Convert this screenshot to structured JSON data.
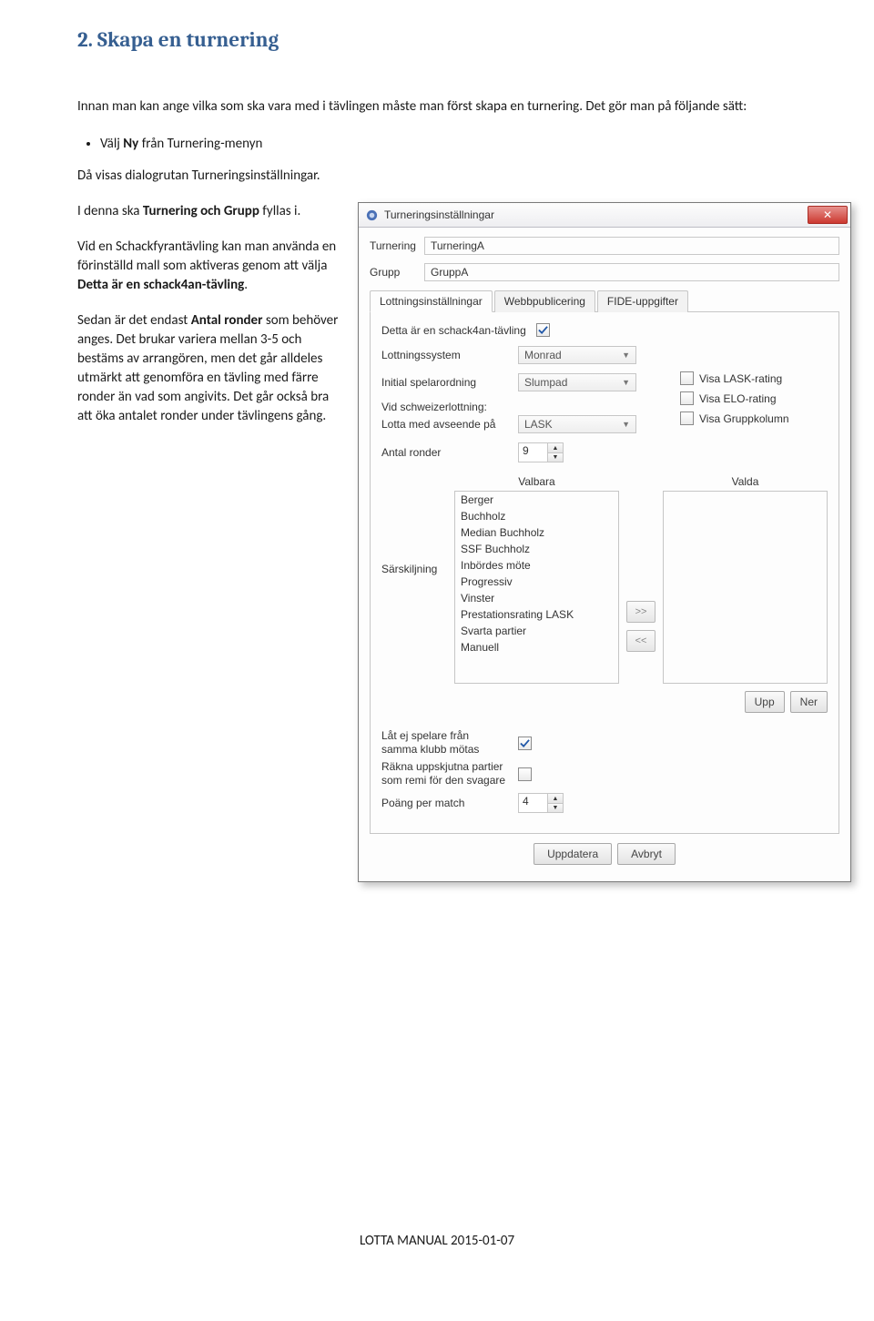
{
  "doc": {
    "heading": "2. Skapa en turnering",
    "intro": "Innan man kan ange vilka som ska vara med i tävlingen måste man först skapa en turnering. Det gör man på följande sätt:",
    "bullet1_pre": "Välj ",
    "bullet1_bold": "Ny",
    "bullet1_post": " från Turnering-menyn",
    "p_davisas": "Då visas dialogrutan Turneringsinställningar.",
    "p_idenna_pre": "I denna ska ",
    "p_idenna_bold": "Turnering och Grupp",
    "p_idenna_post": " fyllas i.",
    "p_viden": "Vid en Schackfyrantävling kan man använda en förinställd mall som aktiveras genom att välja ",
    "p_viden_bold": "Detta är en schack4an-tävling",
    "p_viden_post": ".",
    "p_sedan_pre": "Sedan är det endast ",
    "p_sedan_bold": "Antal ronder",
    "p_sedan_post": " som behöver anges. Det brukar variera mellan 3-5 och bestäms av arrangören, men det går alldeles utmärkt att genomföra en tävling med färre ronder än vad som angivits. Det går också bra att öka antalet ronder under tävlingens gång.",
    "footer": "LOTTA MANUAL 2015-01-07"
  },
  "dialog": {
    "title": "Turneringsinställningar",
    "close": "✕",
    "turnering_label": "Turnering",
    "turnering_value": "TurneringA",
    "grupp_label": "Grupp",
    "grupp_value": "GruppA",
    "tabs": {
      "t1": "Lottningsinställningar",
      "t2": "Webbpublicering",
      "t3": "FIDE-uppgifter"
    },
    "s4an_label": "Detta är en schack4an-tävling",
    "lott": {
      "lottningssystem_label": "Lottningssystem",
      "lottningssystem_value": "Monrad",
      "initial_label": "Initial spelarordning",
      "initial_value": "Slumpad",
      "schweizer_label": "Vid schweizerlottning:",
      "lotta_label": "Lotta med avseende på",
      "lotta_value": "LASK",
      "antal_label": "Antal ronder",
      "antal_value": "9",
      "visa_lask": "Visa LASK-rating",
      "visa_elo": "Visa ELO-rating",
      "visa_grupp": "Visa Gruppkolumn"
    },
    "sarskiljning_label": "Särskiljning",
    "valbara_head": "Valbara",
    "valda_head": "Valda",
    "valbara_items": [
      "Berger",
      "Buchholz",
      "Median Buchholz",
      "SSF Buchholz",
      "Inbördes möte",
      "Progressiv",
      "Vinster",
      "Prestationsrating LASK",
      "Svarta partier",
      "Manuell"
    ],
    "move_r": ">>",
    "move_l": "<<",
    "btn_upp": "Upp",
    "btn_ner": "Ner",
    "lat_ej_label1": "Låt ej spelare från",
    "lat_ej_label2": "samma klubb mötas",
    "rakna_label1": "Räkna uppskjutna partier",
    "rakna_label2": "som remi för den svagare",
    "poang_label": "Poäng per match",
    "poang_value": "4",
    "btn_uppdatera": "Uppdatera",
    "btn_avbryt": "Avbryt"
  }
}
